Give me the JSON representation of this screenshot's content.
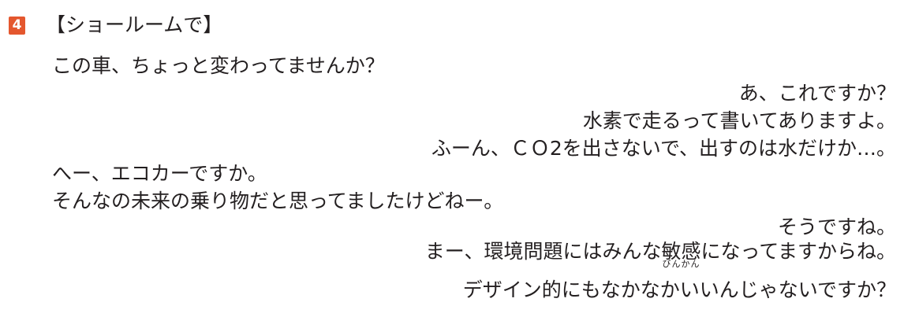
{
  "section": {
    "number": "4",
    "heading": "【ショールームで】"
  },
  "lines": [
    {
      "text": "この車、ちょっと変わってませんか？"
    },
    {
      "text": "あ、これですか？"
    },
    {
      "text": "水素で走るって書いてありますよ。"
    },
    {
      "text": "ふーん、ＣＯ2を出さないで、出すのは水だけか…。"
    },
    {
      "text": "へー、エコカーですか。"
    },
    {
      "text": "そんなの未来の乗り物だと思ってましたけどねー。"
    },
    {
      "text": "そうですね。"
    },
    {
      "before": "まー、環境問題にはみんな",
      "ruby_base": "敏感",
      "ruby_reading": "びんかん",
      "after": "になってますからね。"
    },
    {
      "text": "デザイン的にもなかなかいいんじゃないですか？"
    }
  ]
}
